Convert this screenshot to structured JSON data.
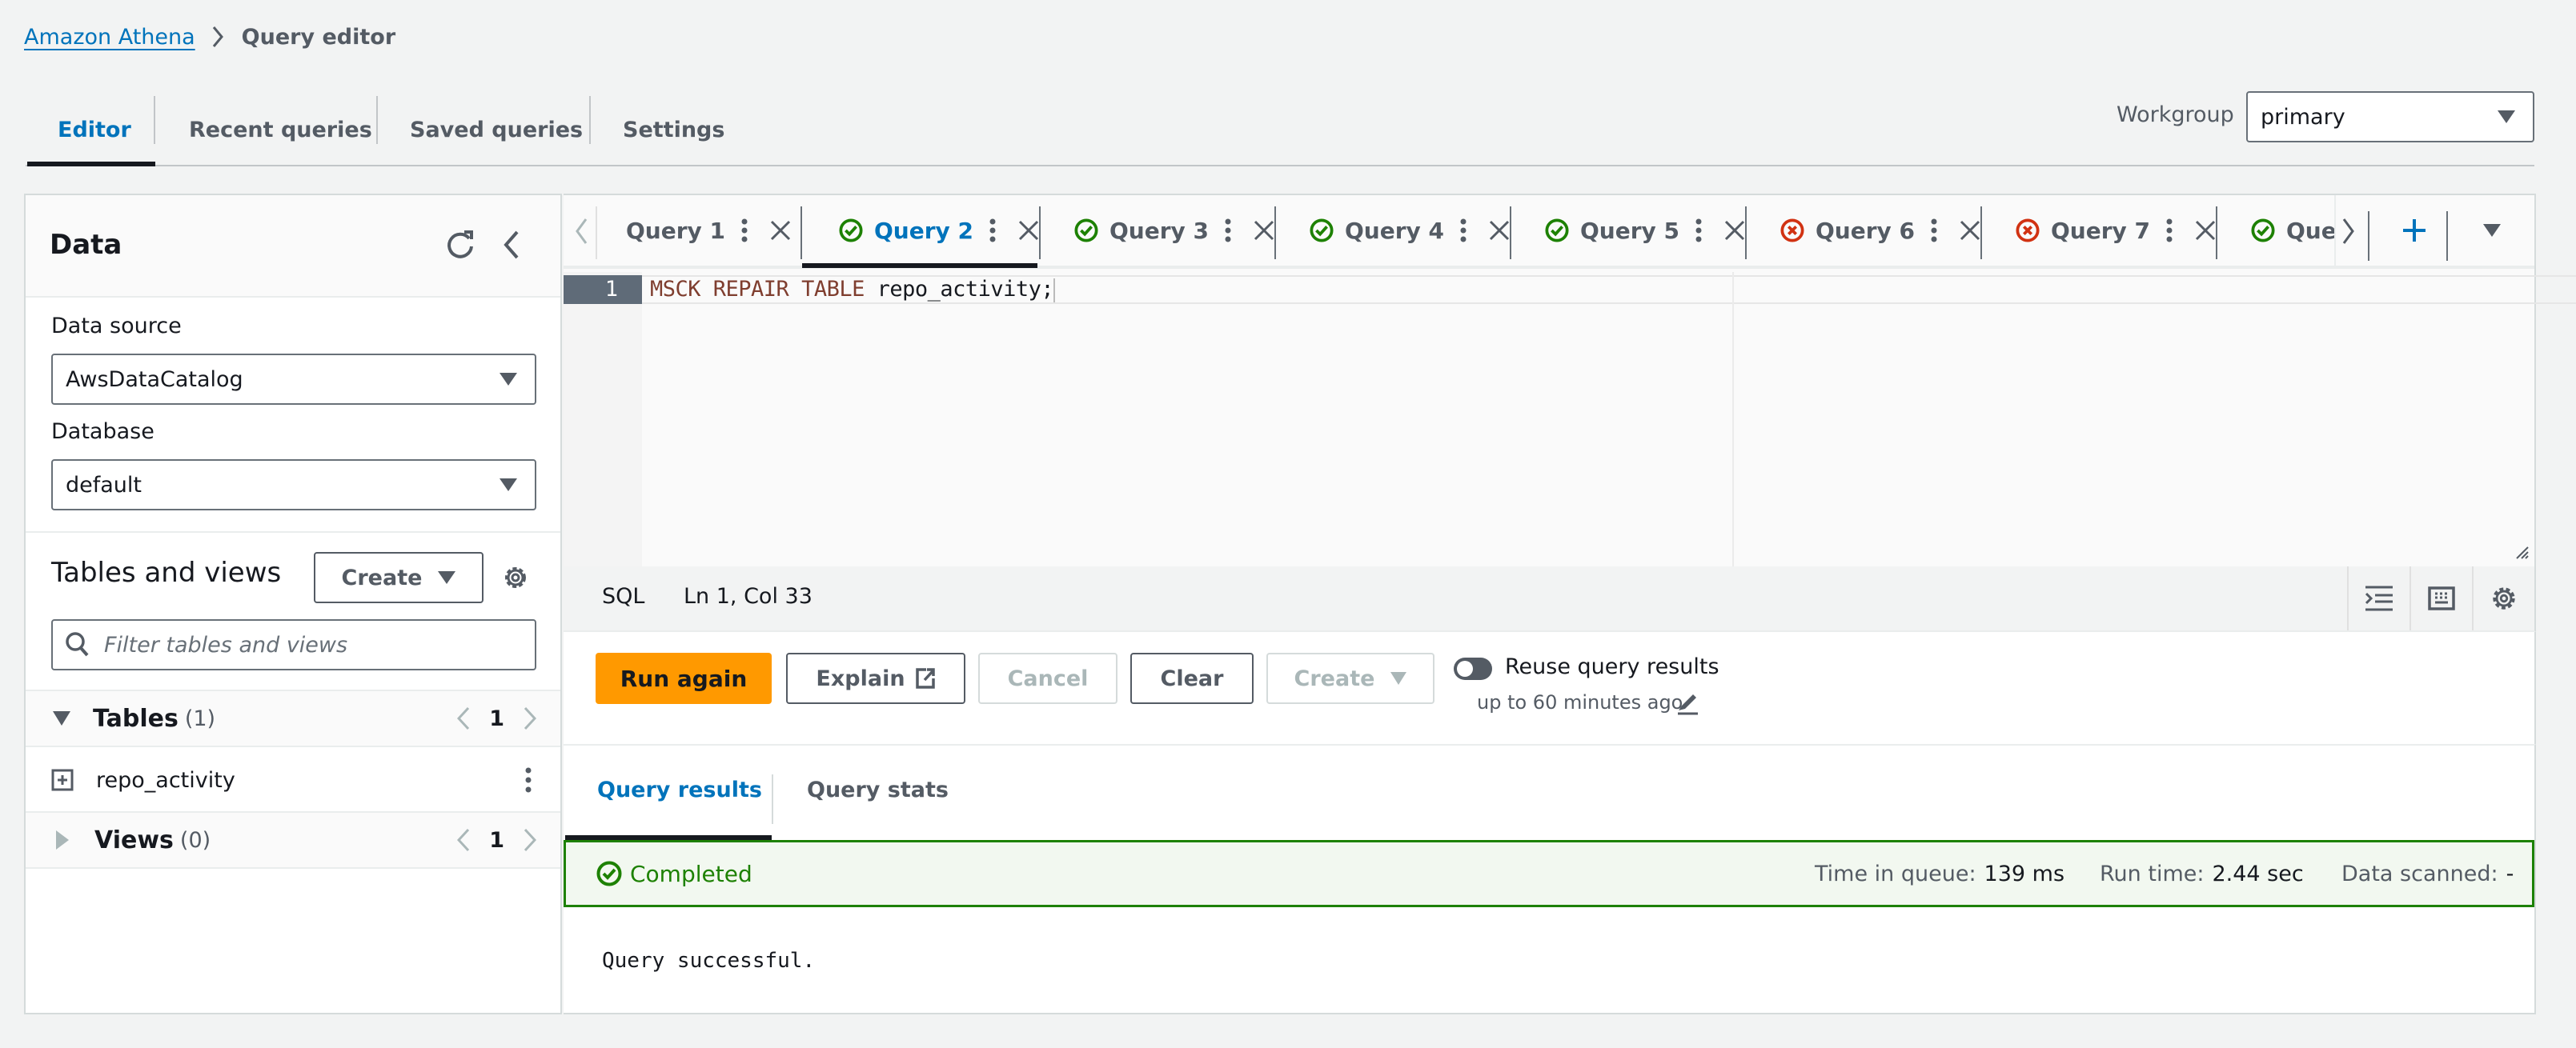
{
  "breadcrumb": {
    "root": "Amazon Athena",
    "current": "Query editor"
  },
  "top_tabs": [
    {
      "label": "Editor",
      "active": true
    },
    {
      "label": "Recent queries",
      "active": false
    },
    {
      "label": "Saved queries",
      "active": false
    },
    {
      "label": "Settings",
      "active": false
    }
  ],
  "workgroup": {
    "label": "Workgroup",
    "value": "primary"
  },
  "data_panel": {
    "title": "Data",
    "data_source_label": "Data source",
    "data_source_value": "AwsDataCatalog",
    "database_label": "Database",
    "database_value": "default",
    "tables_views_title": "Tables and views",
    "create_label": "Create",
    "filter_placeholder": "Filter tables and views",
    "tables": {
      "label": "Tables",
      "count": "(1)",
      "page": "1"
    },
    "table_items": [
      {
        "name": "repo_activity"
      }
    ],
    "views": {
      "label": "Views",
      "count": "(0)",
      "page": "1"
    }
  },
  "query_tabs": [
    {
      "label": "Query 1",
      "status": "none",
      "active": false
    },
    {
      "label": "Query 2",
      "status": "success",
      "active": true
    },
    {
      "label": "Query 3",
      "status": "success",
      "active": false
    },
    {
      "label": "Query 4",
      "status": "success",
      "active": false
    },
    {
      "label": "Query 5",
      "status": "success",
      "active": false
    },
    {
      "label": "Query 6",
      "status": "failed",
      "active": false
    },
    {
      "label": "Query 7",
      "status": "failed",
      "active": false
    },
    {
      "label": "Query",
      "status": "success",
      "active": false
    }
  ],
  "editor": {
    "line_number": "1",
    "keywords": "MSCK REPAIR TABLE",
    "identifier": "repo_activity;",
    "language": "SQL",
    "cursor_position": "Ln 1, Col 33"
  },
  "actions": {
    "run_again": "Run again",
    "explain": "Explain",
    "cancel": "Cancel",
    "clear": "Clear",
    "create": "Create",
    "reuse_label": "Reuse query results",
    "reuse_sub": "up to 60 minutes ago",
    "reuse_enabled": false
  },
  "results": {
    "tabs": [
      {
        "label": "Query results",
        "active": true
      },
      {
        "label": "Query stats",
        "active": false
      }
    ],
    "status": "Completed",
    "time_in_queue_label": "Time in queue:",
    "time_in_queue_value": "139 ms",
    "run_time_label": "Run time:",
    "run_time_value": "2.44 sec",
    "data_scanned_label": "Data scanned:",
    "data_scanned_value": "-",
    "message": "Query successful."
  },
  "colors": {
    "link": "#0073bb",
    "primary_button": "#ff9900",
    "success": "#1d8102",
    "error": "#d13212",
    "keyword": "#7f3e2f"
  }
}
